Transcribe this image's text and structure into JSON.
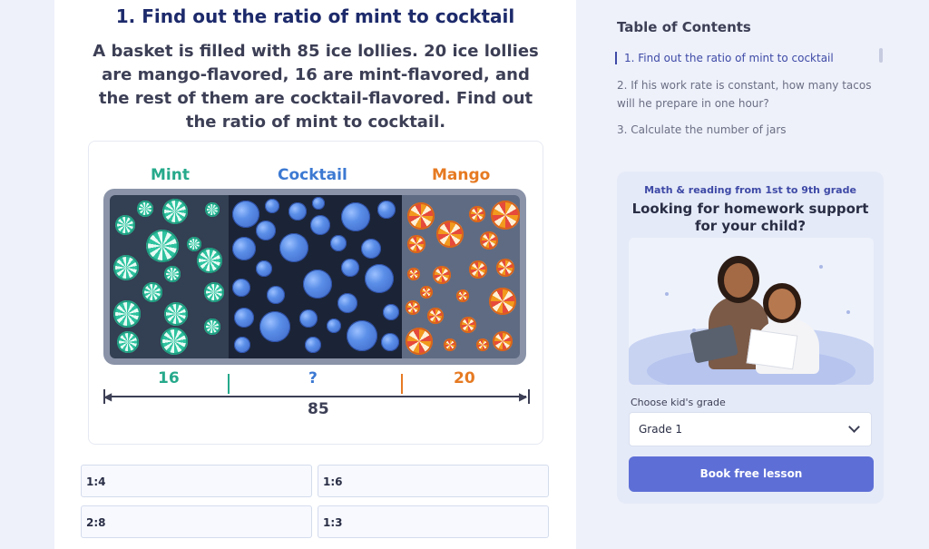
{
  "lesson": {
    "title": "1. Find out the ratio of mint to cocktail",
    "question": "A basket is filled with 85 ice lollies. 20 ice lollies are mango-flavored, 16 are mint-flavored, and the rest of them are cocktail-flavored. Find out the ratio of mint to cocktail.",
    "figure": {
      "labels": {
        "mint": "Mint",
        "cocktail": "Cocktail",
        "mango": "Mango"
      },
      "values": {
        "mint": "16",
        "cocktail": "?",
        "mango": "20"
      },
      "total": "85",
      "colors": {
        "mint": "#26a98b",
        "cocktail": "#3c79d2",
        "mango": "#e67a22"
      }
    },
    "options": [
      "1:4",
      "1:6",
      "2:8",
      "1:3"
    ]
  },
  "toc": {
    "title": "Table of Contents",
    "items": [
      "1. Find out the ratio of mint to cocktail",
      "2. If his work rate is constant, how many tacos will he prepare in one hour?",
      "3. Calculate the number of jars"
    ]
  },
  "promo": {
    "subtitle": "Math & reading from 1st to 9th grade",
    "headline": "Looking for homework support for your child?",
    "grade_label": "Choose kid's grade",
    "grade_value": "Grade 1",
    "button_label": "Book free lesson",
    "accent": "#5d6fd6"
  }
}
